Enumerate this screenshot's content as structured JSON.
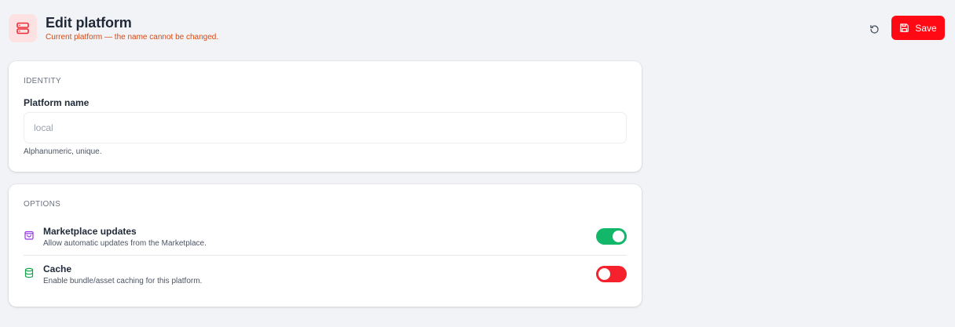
{
  "header": {
    "title": "Edit platform",
    "subtitle": "Current platform — the name cannot be changed.",
    "icon": "server-icon",
    "save_label": "Save",
    "reset_icon": "reset-icon"
  },
  "identity": {
    "section_title": "IDENTITY",
    "field_label": "Platform name",
    "field_value": "local",
    "help_text": "Alphanumeric, unique."
  },
  "options": {
    "section_title": "OPTIONS",
    "items": [
      {
        "label": "Marketplace updates",
        "description": "Allow automatic updates from the Marketplace.",
        "icon": "shopping-bag-icon",
        "enabled": true
      },
      {
        "label": "Cache",
        "description": "Enable bundle/asset caching for this platform.",
        "icon": "database-icon",
        "enabled": false
      }
    ]
  },
  "colors": {
    "accent": "#ff0a14",
    "toggle_on": "#12b76a",
    "toggle_off": "#f5222d",
    "subtitle": "#d9480f",
    "marketplace_icon": "#9333ea",
    "cache_icon": "#16a34a"
  }
}
